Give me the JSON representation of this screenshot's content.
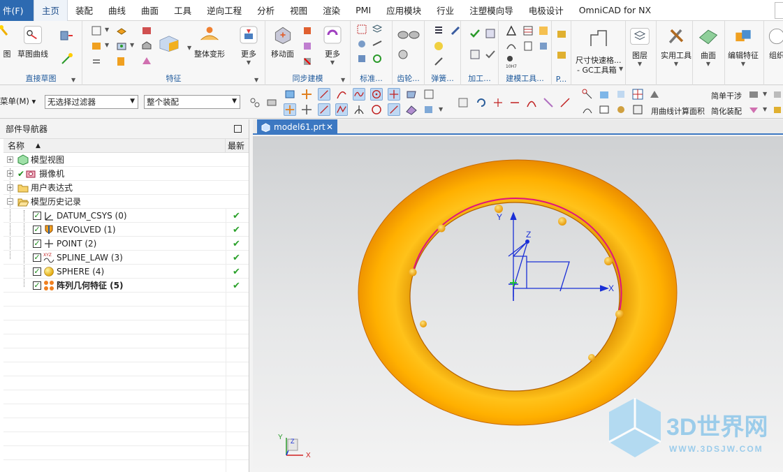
{
  "menu": {
    "file_label": "件(F)",
    "tabs": [
      "主页",
      "装配",
      "曲线",
      "曲面",
      "工具",
      "逆向工程",
      "分析",
      "视图",
      "渲染",
      "PMI",
      "应用模块",
      "行业",
      "注塑模向导",
      "电极设计",
      "OmniCAD for NX"
    ],
    "active": "主页"
  },
  "ribbon": {
    "direct_sketch": {
      "label": "直接草图",
      "btn1": "图",
      "btn2": "草图曲线"
    },
    "feature": {
      "label": "特征",
      "global_deform": "整体变形",
      "more": "更多"
    },
    "sync": {
      "label": "同步建模",
      "move_face": "移动面",
      "more": "更多"
    },
    "small_groups": [
      "标准...",
      "齿轮...",
      "弹簧...",
      "加工...",
      "建模工具...",
      "P..."
    ],
    "dim": {
      "line1": "尺寸快速格...",
      "line2": "- GC工具箱"
    },
    "layer": "图层",
    "utility": "实用工具",
    "surface": "曲面",
    "edit_feature": "编辑特征",
    "organize": "组织"
  },
  "toolbar": {
    "menu_label": "菜单(M)",
    "filter_value": "无选择过滤器",
    "scope_value": "整个装配",
    "text1": "简单干涉",
    "text2": "用曲线计算面积",
    "text3": "简化装配"
  },
  "navigator": {
    "title": "部件导航器",
    "col_name": "名称",
    "col_latest": "最新",
    "nodes": [
      {
        "label": "模型视图",
        "check": false
      },
      {
        "label": "摄像机",
        "check": true
      },
      {
        "label": "用户表达式",
        "check": false
      },
      {
        "label": "模型历史记录",
        "check": false
      }
    ],
    "history": [
      {
        "label": "DATUM_CSYS (0)",
        "bold": false
      },
      {
        "label": "REVOLVED (1)",
        "bold": false
      },
      {
        "label": "POINT (2)",
        "bold": false
      },
      {
        "label": "SPLINE_LAW (3)",
        "bold": false
      },
      {
        "label": "SPHERE (4)",
        "bold": false
      },
      {
        "label": "阵列几何特征 (5)",
        "bold": true
      }
    ],
    "latest_mark": "✔"
  },
  "document": {
    "tab_title": "model61.prt"
  },
  "viewport": {
    "axis_x": "X",
    "axis_y": "Y",
    "axis_z": "Z",
    "mini_x": "X",
    "mini_y": "Y",
    "mini_z": "Z"
  },
  "watermark": {
    "brand": "3D世界网",
    "url": "WWW.3DSJW.COM"
  },
  "colors": {
    "torus": "#ffb400",
    "accent": "#3c78c2",
    "curve": "#e0137d",
    "csys": "#1a2fd6"
  }
}
